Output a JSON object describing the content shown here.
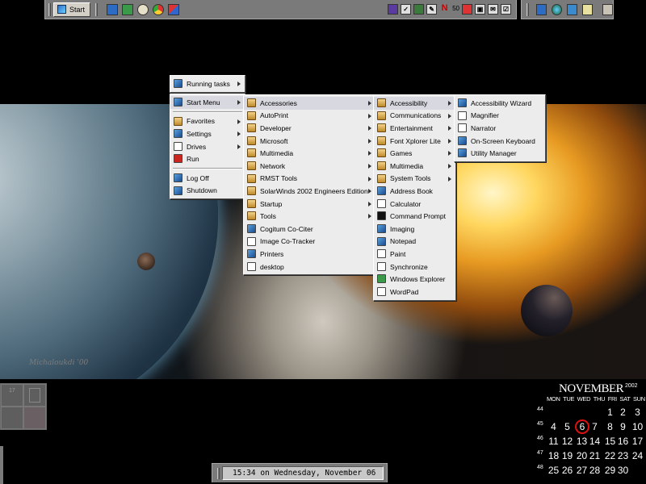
{
  "taskbar": {
    "start_label": "Start",
    "quick_icons": [
      "desktop-icon",
      "explorer-icon",
      "media-icon",
      "browser-icon",
      "windows-icon"
    ],
    "tray_icons": [
      "shield-icon",
      "check-icon",
      "image-icon",
      "pen-icon",
      "norton-icon",
      "speaker-icon",
      "red-box-icon",
      "toolbox-icon",
      "mail-icon",
      "checkbox-icon"
    ],
    "tray_norton": "N",
    "tray_count": "50"
  },
  "menus": {
    "root": [
      {
        "label": "Running tasks",
        "icon": "tasks-icon",
        "submenu": true
      },
      {
        "label": "Start Menu",
        "icon": "startmenu-icon",
        "submenu": true
      },
      {
        "label": "Favorites",
        "icon": "favorites-icon",
        "submenu": true
      },
      {
        "label": "Settings",
        "icon": "settings-icon",
        "submenu": true
      },
      {
        "label": "Drives",
        "icon": "drives-icon",
        "submenu": true
      },
      {
        "label": "Run",
        "icon": "run-icon",
        "submenu": false
      },
      {
        "label": "Log Off",
        "icon": "logoff-icon",
        "submenu": false
      },
      {
        "label": "Shutdown",
        "icon": "shutdown-icon",
        "submenu": false
      }
    ],
    "programs": [
      {
        "label": "Accessories",
        "submenu": true
      },
      {
        "label": "AutoPrint",
        "submenu": true
      },
      {
        "label": "Developer",
        "submenu": true
      },
      {
        "label": "Microsoft",
        "submenu": true
      },
      {
        "label": "Multimedia",
        "submenu": true
      },
      {
        "label": "Network",
        "submenu": true
      },
      {
        "label": "RMST Tools",
        "submenu": true
      },
      {
        "label": "SolarWinds 2002 Engineers Edition",
        "submenu": true
      },
      {
        "label": "Startup",
        "submenu": true
      },
      {
        "label": "Tools",
        "submenu": true
      },
      {
        "label": "Cogitum Co-Citer",
        "submenu": false
      },
      {
        "label": "Image Co-Tracker",
        "submenu": false
      },
      {
        "label": "Printers",
        "submenu": false
      },
      {
        "label": "desktop",
        "submenu": false
      }
    ],
    "accessories": [
      {
        "label": "Accessibility",
        "submenu": true
      },
      {
        "label": "Communications",
        "submenu": true
      },
      {
        "label": "Entertainment",
        "submenu": true
      },
      {
        "label": "Font Xplorer Lite",
        "submenu": true
      },
      {
        "label": "Games",
        "submenu": true
      },
      {
        "label": "Multimedia",
        "submenu": true
      },
      {
        "label": "System Tools",
        "submenu": true
      },
      {
        "label": "Address Book",
        "submenu": false
      },
      {
        "label": "Calculator",
        "submenu": false
      },
      {
        "label": "Command Prompt",
        "submenu": false
      },
      {
        "label": "Imaging",
        "submenu": false
      },
      {
        "label": "Notepad",
        "submenu": false
      },
      {
        "label": "Paint",
        "submenu": false
      },
      {
        "label": "Synchronize",
        "submenu": false
      },
      {
        "label": "Windows Explorer",
        "submenu": false
      },
      {
        "label": "WordPad",
        "submenu": false
      }
    ],
    "accessibility": [
      {
        "label": "Accessibility Wizard"
      },
      {
        "label": "Magnifier"
      },
      {
        "label": "Narrator"
      },
      {
        "label": "On-Screen Keyboard"
      },
      {
        "label": "Utility Manager"
      }
    ]
  },
  "calendar": {
    "month": "NOVEMBER",
    "year": "2002",
    "weekdays": [
      "MON",
      "TUE",
      "WED",
      "THU",
      "FRI",
      "SAT",
      "SUN"
    ],
    "today": "6",
    "weeks": [
      {
        "num": "44",
        "days": [
          "",
          "",
          "",
          "",
          "1",
          "2",
          "3"
        ]
      },
      {
        "num": "45",
        "days": [
          "4",
          "5",
          "6",
          "7",
          "8",
          "9",
          "10"
        ]
      },
      {
        "num": "46",
        "days": [
          "11",
          "12",
          "13",
          "14",
          "15",
          "16",
          "17"
        ]
      },
      {
        "num": "47",
        "days": [
          "18",
          "19",
          "20",
          "21",
          "22",
          "23",
          "24"
        ]
      },
      {
        "num": "48",
        "days": [
          "25",
          "26",
          "27",
          "28",
          "29",
          "30",
          ""
        ]
      }
    ]
  },
  "status": {
    "clock": "15:34 on Wednesday, November 06"
  },
  "wallpaper": {
    "signature": "Michaloukdi '00"
  },
  "pager": {
    "label": "17"
  },
  "colors": {
    "menu_bg": "#ececec",
    "highlight": "#d8d8e0",
    "today_ring": "#e01010",
    "taskbar": "#7a7a7a"
  }
}
